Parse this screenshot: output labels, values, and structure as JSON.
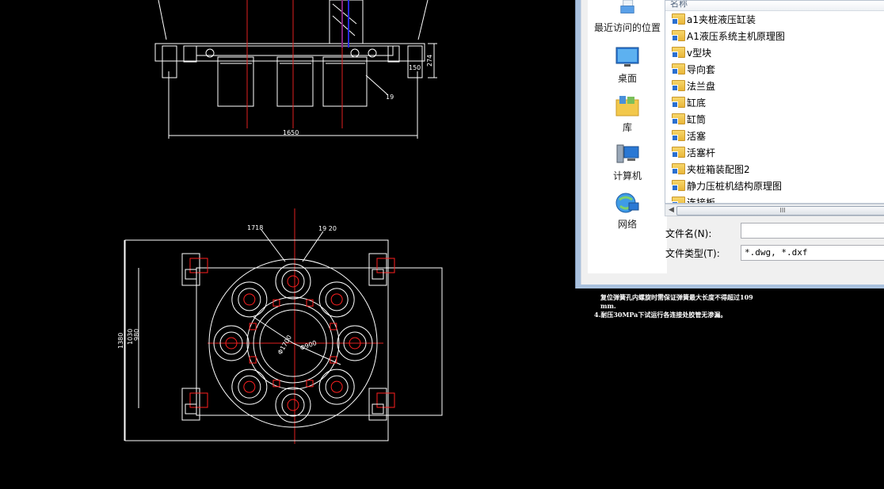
{
  "drawing": {
    "dims": {
      "top_width": "1650",
      "top_height": "274",
      "top_small": "150",
      "callout_19": "19",
      "label_1718": "1718",
      "label_1920": "19 20",
      "left_1": "1380",
      "left_2": "1030",
      "left_3": "980",
      "phi_1": "Φ1700",
      "phi_2": "Φ900"
    },
    "notes": {
      "line1": "复位弹簧孔内螺旋时需保证弹簧最大长度不得超过109",
      "line2": "mm.",
      "line3": "4.耐压30MPa下试运行各连接处胶管无渗漏。"
    },
    "colors": {
      "line": "#ffffff",
      "center": "#ff2020",
      "accent": "#3a3aff"
    }
  },
  "dialog": {
    "places": [
      {
        "label": "最近访问的位置",
        "icon": "recent-places-icon"
      },
      {
        "label": "桌面",
        "icon": "desktop-icon"
      },
      {
        "label": "库",
        "icon": "library-icon"
      },
      {
        "label": "计算机",
        "icon": "computer-icon"
      },
      {
        "label": "网络",
        "icon": "network-icon"
      }
    ],
    "column_header": "名称",
    "files": [
      "a1夹桩液压缸装",
      "A1液压系统主机原理图",
      "v型块",
      "导向套",
      "法兰盘",
      "缸底",
      "缸筒",
      "活塞",
      "活塞杆",
      "夹桩箱装配图2",
      "静力压桩机结构原理图",
      "连接板"
    ],
    "scroll_label": "III",
    "filename_label": "文件名(N):",
    "filename_value": "",
    "filetype_label": "文件类型(T):",
    "filetype_value": "*.dwg, *.dxf"
  }
}
